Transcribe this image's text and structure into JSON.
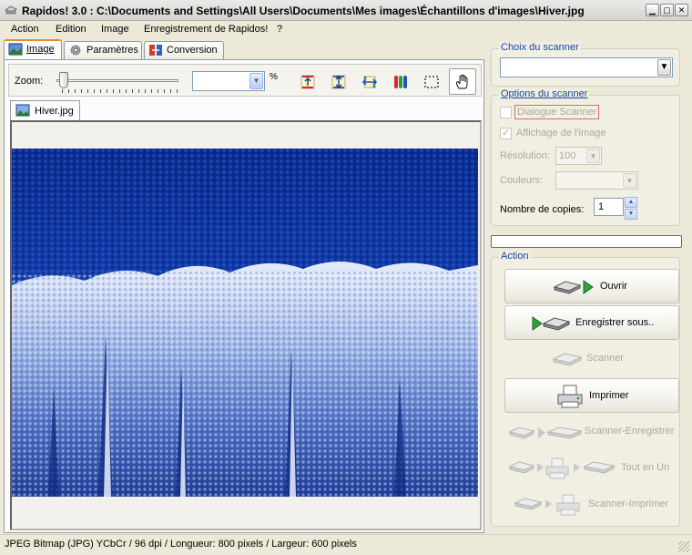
{
  "window": {
    "title": "Rapidos! 3.0 : C:\\Documents and Settings\\All Users\\Documents\\Mes images\\Échantillons d'images\\Hiver.jpg",
    "minimize_icon": "minimize-icon",
    "maximize_icon": "maximize-icon",
    "close_icon": "close-icon"
  },
  "menu": [
    {
      "label": "Action"
    },
    {
      "label": "Edition"
    },
    {
      "label": "Image"
    },
    {
      "label": "Enregistrement de Rapidos!"
    },
    {
      "label": "?"
    }
  ],
  "tabs": [
    {
      "label": "Image",
      "active": true,
      "icon": "image-icon"
    },
    {
      "label": "Paramètres",
      "active": false,
      "icon": "gear-icon"
    },
    {
      "label": "Conversion",
      "active": false,
      "icon": "convert-icon"
    }
  ],
  "toolbar": {
    "zoom_label": "Zoom:",
    "zoom_value": "",
    "percent_label": "%",
    "zoom_slider_level": 0,
    "tools": [
      {
        "icon": "fit-width-icon"
      },
      {
        "icon": "fit-height-icon"
      },
      {
        "icon": "fit-page-icon"
      },
      {
        "icon": "color-bars-icon"
      },
      {
        "icon": "selection-icon"
      },
      {
        "icon": "hand-icon",
        "selected": true
      }
    ]
  },
  "document": {
    "tab_label": "Hiver.jpg"
  },
  "scanner": {
    "choice_title": "Choix du scanner",
    "selected_scanner": "",
    "options_title": "Options  du scanner",
    "dialog_label": "Dialogue Scanner",
    "dialog_checked": false,
    "display_label": "Affichage de l'image",
    "display_checked": true,
    "resolution_label": "Résolution:",
    "resolution_value": "100",
    "colors_label": "Couleurs:",
    "colors_value": "",
    "copies_label": "Nombre de copies:",
    "copies_value": "1",
    "progress": 0
  },
  "actions": {
    "title": "Action",
    "open": "Ouvrir",
    "save_as": "Enregistrer sous..",
    "scan": "Scanner",
    "print": "Imprimer",
    "scan_save": "Scanner-Enregistrer",
    "all_in_one": "Tout en Un",
    "scan_print": "Scanner-Imprimer"
  },
  "status": {
    "text": "JPEG Bitmap (JPG) YCbCr / 96 dpi / Longueur: 800 pixels / Largeur: 600 pixels"
  },
  "colors": {
    "accent_tab": "#e68b2c",
    "group_title": "#1645a5",
    "forest_dark": "#0b2a8a",
    "forest_frost": "#e8eef8"
  }
}
